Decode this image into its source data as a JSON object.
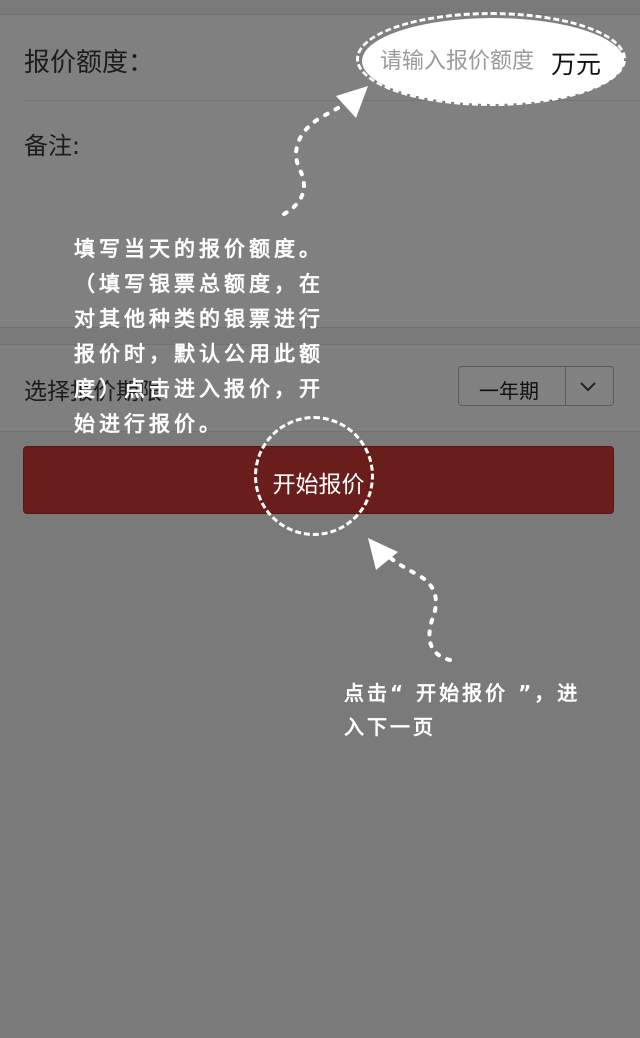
{
  "form": {
    "amount_label": "报价额度：",
    "amount_placeholder": "请输入报价额度",
    "amount_value": "",
    "amount_unit": "万元",
    "note_label": "备注:",
    "period_label": "选择报价期限",
    "period_selected": "一年期",
    "start_button_label": "开始报价"
  },
  "annotations": {
    "amount_hint_lines": [
      "填写当天的报价额度。",
      "（填写银票总额度，在",
      "对其他种类的银票进行",
      "报价时，默认公用此额",
      "度）点击进入报价，开",
      "始进行报价。"
    ],
    "button_hint_lines": [
      "点击“ 开始报价 ”，进",
      "入下一页"
    ]
  },
  "icons": {
    "select_arrow": "chevron-down-icon"
  },
  "colors": {
    "overlay_gray": "#7a7a7a",
    "button_red": "#6a1e1c",
    "annotation_white": "#ffffff"
  }
}
